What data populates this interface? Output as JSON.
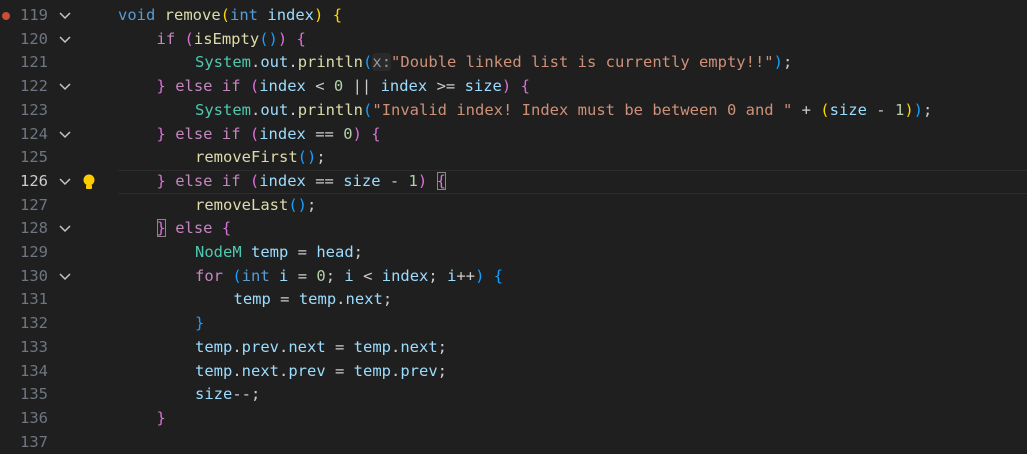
{
  "editor": {
    "hint_label": "x:",
    "lines": [
      {
        "num": "119",
        "breakpoint": true,
        "fold": true,
        "indent": 0,
        "toks": [
          [
            "void",
            "kw"
          ],
          [
            " "
          ],
          [
            "remove",
            "fn"
          ],
          [
            "(",
            "b1"
          ],
          [
            "int",
            "kw"
          ],
          [
            " "
          ],
          [
            "index",
            "var"
          ],
          [
            ")",
            "b1"
          ],
          [
            " "
          ],
          [
            "{",
            "b1"
          ]
        ]
      },
      {
        "num": "120",
        "fold": true,
        "indent": 1,
        "toks": [
          [
            "if",
            "ctl"
          ],
          [
            " "
          ],
          [
            "(",
            "b2"
          ],
          [
            "isEmpty",
            "fn"
          ],
          [
            "()",
            "b3"
          ],
          [
            ")",
            "b2"
          ],
          [
            " "
          ],
          [
            "{",
            "b2"
          ]
        ]
      },
      {
        "num": "121",
        "indent": 2,
        "toks": [
          [
            "System",
            "ty"
          ],
          [
            "."
          ],
          [
            "out",
            "var"
          ],
          [
            "."
          ],
          [
            "println",
            "fn"
          ],
          [
            "(",
            "b3"
          ],
          [
            "x:",
            "hint"
          ],
          [
            "\"Double linked list is currently empty!!\"",
            "str"
          ],
          [
            ")",
            "b3"
          ],
          [
            ";"
          ]
        ]
      },
      {
        "num": "122",
        "fold": true,
        "indent": 1,
        "toks": [
          [
            "}",
            "b2"
          ],
          [
            " "
          ],
          [
            "else",
            "ctl"
          ],
          [
            " "
          ],
          [
            "if",
            "ctl"
          ],
          [
            " "
          ],
          [
            "(",
            "b2"
          ],
          [
            "index",
            "var"
          ],
          [
            " < "
          ],
          [
            "0",
            "num"
          ],
          [
            " || "
          ],
          [
            "index",
            "var"
          ],
          [
            " >= "
          ],
          [
            "size",
            "var"
          ],
          [
            ")",
            "b2"
          ],
          [
            " "
          ],
          [
            "{",
            "b2"
          ]
        ]
      },
      {
        "num": "123",
        "indent": 2,
        "toks": [
          [
            "System",
            "ty"
          ],
          [
            "."
          ],
          [
            "out",
            "var"
          ],
          [
            "."
          ],
          [
            "println",
            "fn"
          ],
          [
            "(",
            "b3"
          ],
          [
            "\"Invalid index! Index must be between 0 and \"",
            "str"
          ],
          [
            " + "
          ],
          [
            "(",
            "b1"
          ],
          [
            "size",
            "var"
          ],
          [
            " - "
          ],
          [
            "1",
            "num"
          ],
          [
            ")",
            "b1"
          ],
          [
            ")",
            "b3"
          ],
          [
            ";"
          ]
        ]
      },
      {
        "num": "124",
        "fold": true,
        "indent": 1,
        "toks": [
          [
            "}",
            "b2"
          ],
          [
            " "
          ],
          [
            "else",
            "ctl"
          ],
          [
            " "
          ],
          [
            "if",
            "ctl"
          ],
          [
            " "
          ],
          [
            "(",
            "b2"
          ],
          [
            "index",
            "var"
          ],
          [
            " == "
          ],
          [
            "0",
            "num"
          ],
          [
            ")",
            "b2"
          ],
          [
            " "
          ],
          [
            "{",
            "b2"
          ]
        ]
      },
      {
        "num": "125",
        "indent": 2,
        "toks": [
          [
            "removeFirst",
            "fn"
          ],
          [
            "()",
            "b3"
          ],
          [
            ";"
          ]
        ]
      },
      {
        "num": "126",
        "fold": true,
        "bulb": true,
        "current": true,
        "indent": 1,
        "toks": [
          [
            "}",
            "b2"
          ],
          [
            " "
          ],
          [
            "else",
            "ctl"
          ],
          [
            " "
          ],
          [
            "if",
            "ctl"
          ],
          [
            " "
          ],
          [
            "(",
            "b2"
          ],
          [
            "index",
            "var"
          ],
          [
            " == "
          ],
          [
            "size",
            "var"
          ],
          [
            " - "
          ],
          [
            "1",
            "num"
          ],
          [
            ")",
            "b2"
          ],
          [
            " "
          ],
          [
            "{",
            "b2 bmatch"
          ]
        ]
      },
      {
        "num": "127",
        "indent": 2,
        "toks": [
          [
            "removeLast",
            "fn"
          ],
          [
            "()",
            "b3"
          ],
          [
            ";"
          ]
        ]
      },
      {
        "num": "128",
        "fold": true,
        "indent": 1,
        "toks": [
          [
            "}",
            "b2 bmatch"
          ],
          [
            " "
          ],
          [
            "else",
            "ctl"
          ],
          [
            " "
          ],
          [
            "{",
            "b2"
          ]
        ]
      },
      {
        "num": "129",
        "indent": 2,
        "toks": [
          [
            "NodeM",
            "ty"
          ],
          [
            " "
          ],
          [
            "temp",
            "var"
          ],
          [
            " = "
          ],
          [
            "head",
            "var"
          ],
          [
            ";"
          ]
        ]
      },
      {
        "num": "130",
        "fold": true,
        "indent": 2,
        "toks": [
          [
            "for",
            "ctl"
          ],
          [
            " "
          ],
          [
            "(",
            "b3"
          ],
          [
            "int",
            "kw"
          ],
          [
            " "
          ],
          [
            "i",
            "var"
          ],
          [
            " = "
          ],
          [
            "0",
            "num"
          ],
          [
            "; "
          ],
          [
            "i",
            "var"
          ],
          [
            " < "
          ],
          [
            "index",
            "var"
          ],
          [
            "; "
          ],
          [
            "i",
            "var"
          ],
          [
            "++"
          ],
          [
            ")",
            "b3"
          ],
          [
            " "
          ],
          [
            "{",
            "b3"
          ]
        ]
      },
      {
        "num": "131",
        "indent": 3,
        "toks": [
          [
            "temp",
            "var"
          ],
          [
            " = "
          ],
          [
            "temp",
            "var"
          ],
          [
            "."
          ],
          [
            "next",
            "var"
          ],
          [
            ";"
          ]
        ]
      },
      {
        "num": "132",
        "indent": 2,
        "toks": [
          [
            "}",
            "b3"
          ]
        ]
      },
      {
        "num": "133",
        "indent": 2,
        "toks": [
          [
            "temp",
            "var"
          ],
          [
            "."
          ],
          [
            "prev",
            "var"
          ],
          [
            "."
          ],
          [
            "next",
            "var"
          ],
          [
            " = "
          ],
          [
            "temp",
            "var"
          ],
          [
            "."
          ],
          [
            "next",
            "var"
          ],
          [
            ";"
          ]
        ]
      },
      {
        "num": "134",
        "indent": 2,
        "toks": [
          [
            "temp",
            "var"
          ],
          [
            "."
          ],
          [
            "next",
            "var"
          ],
          [
            "."
          ],
          [
            "prev",
            "var"
          ],
          [
            " = "
          ],
          [
            "temp",
            "var"
          ],
          [
            "."
          ],
          [
            "prev",
            "var"
          ],
          [
            ";"
          ]
        ]
      },
      {
        "num": "135",
        "indent": 2,
        "toks": [
          [
            "size",
            "var"
          ],
          [
            "--;"
          ]
        ]
      },
      {
        "num": "136",
        "indent": 1,
        "toks": [
          [
            "}",
            "b2"
          ]
        ]
      },
      {
        "num": "137",
        "indent": 0,
        "toks": []
      }
    ]
  }
}
